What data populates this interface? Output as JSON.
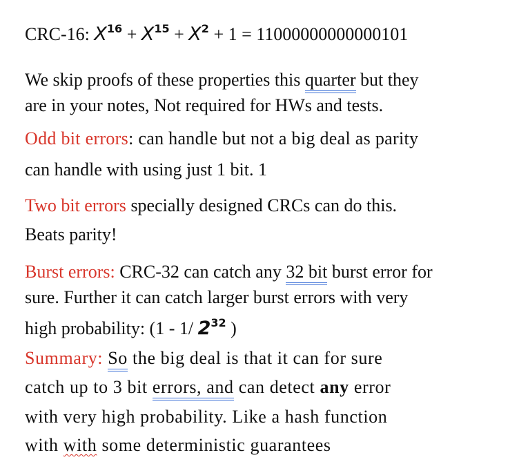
{
  "crc_line": {
    "prefix": "CRC-16: ",
    "t1_base": "X",
    "t1_exp": "16",
    "plus1": " + ",
    "t2_base": "X",
    "t2_exp": "15",
    "plus2": " + ",
    "t3_base": "X",
    "t3_exp": "2",
    "tail": " + 1 = 11000000000000101"
  },
  "intro": {
    "line1_a": "We skip proofs of these properties this ",
    "line1_link": "quarter",
    "line1_b": " but they",
    "line2": "are in your notes,  Not required for HWs and tests."
  },
  "odd": {
    "label": "Odd bit errors",
    "line1_rest": ": can handle but not a big deal as parity",
    "line2": "can handle with using just 1 bit.  1"
  },
  "two": {
    "label": "Two bit errors",
    "line1_rest": " specially designed CRCs can do this.",
    "line2": "Beats parity!"
  },
  "burst": {
    "label": "Burst errors:",
    "line1_a": " CRC-32 can catch any ",
    "line1_link": "32 bit",
    "line1_b": " burst error for",
    "line2": "sure.  Further it can catch larger burst errors with very",
    "line3_a": "high probability: (1 - 1/ ",
    "line3_base": "2",
    "line3_exp": "32",
    "line3_b": " )"
  },
  "summary": {
    "label": "Summary:",
    "line1_sp": " ",
    "line1_link": "So",
    "line1_rest": " the big deal is that it can for sure",
    "line2_a": "catch up to 3 bit ",
    "line2_link": "errors, and",
    "line2_b": " can detect ",
    "line2_bold": "any",
    "line2_c": " error",
    "line3": "with very high probability.  Like a hash function",
    "line4_a": "with ",
    "line4_squig": "with",
    "line4_b": " some deterministic guarantees"
  }
}
